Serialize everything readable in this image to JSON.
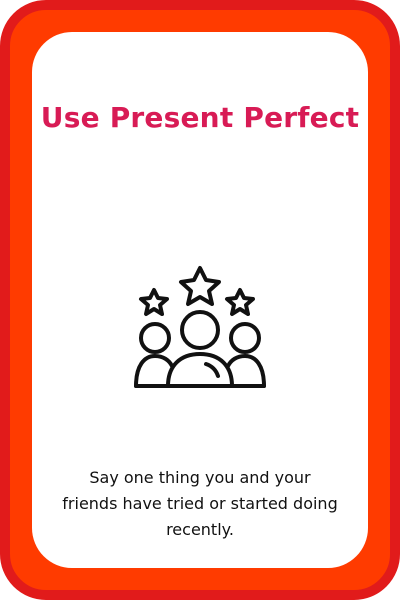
{
  "card": {
    "title": "Use Present Perfect",
    "description": "Say one thing you and your friends have tried or started doing recently."
  },
  "icons": {
    "main": "group-with-stars-icon"
  },
  "colors": {
    "outer_border": "#e11b1b",
    "outer_fill": "#ff3b00",
    "card_bg": "#ffffff",
    "title": "#d81b55",
    "text": "#111111"
  }
}
